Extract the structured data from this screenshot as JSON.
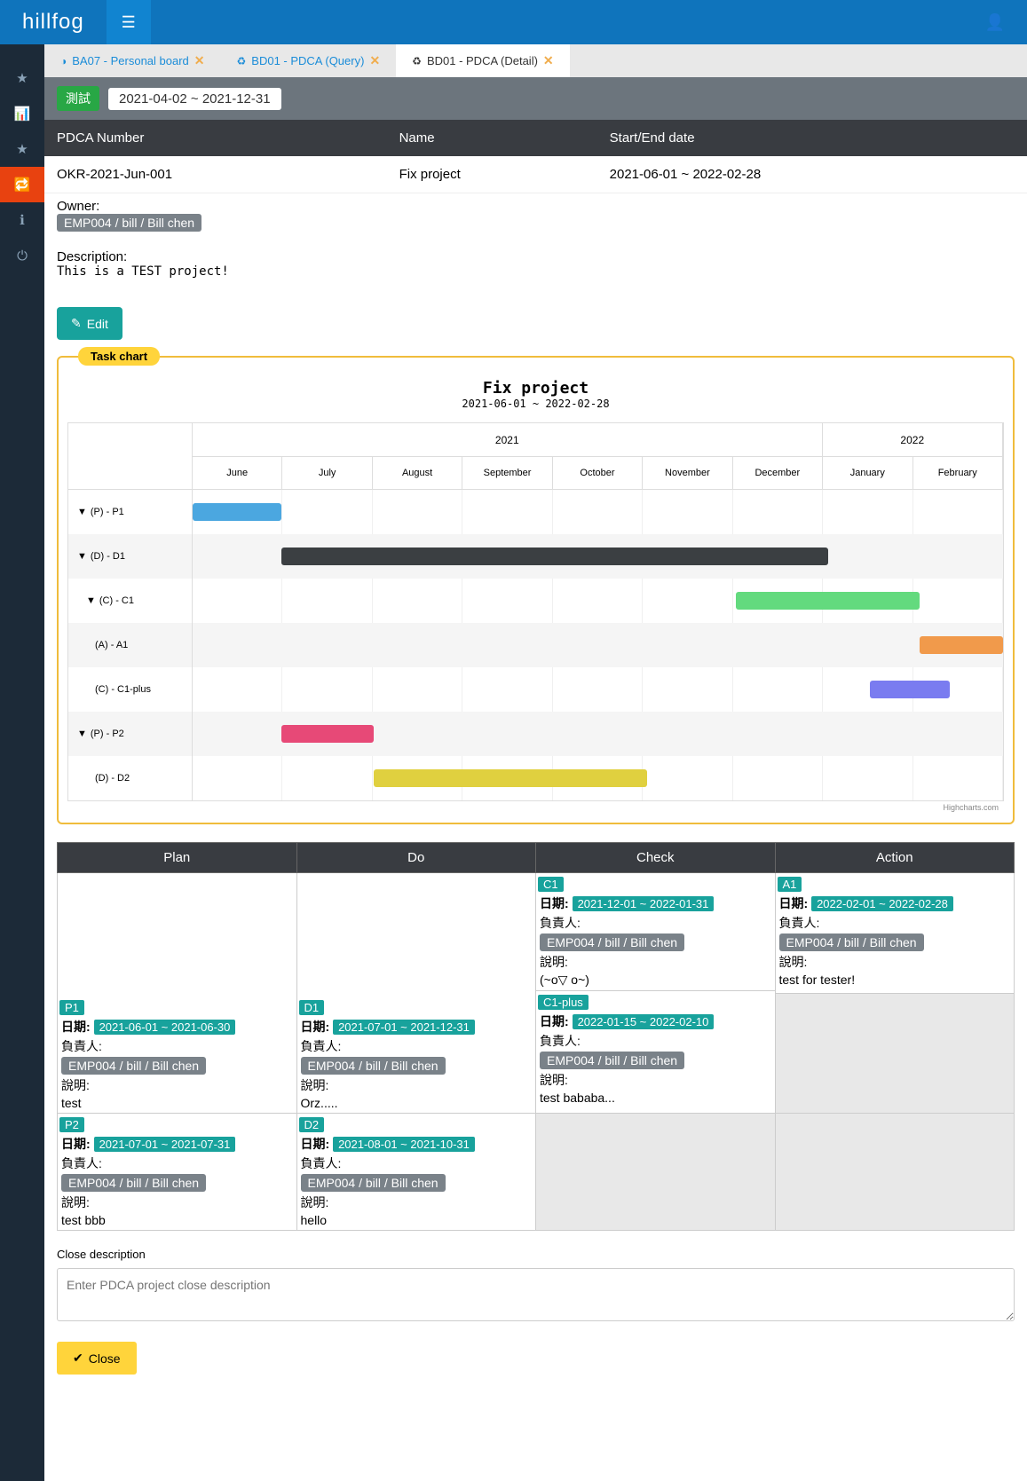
{
  "brand": "hillfog",
  "tabs": [
    {
      "label": "BA07 - Personal board",
      "active": false
    },
    {
      "label": "BD01 - PDCA (Query)",
      "active": false
    },
    {
      "label": "BD01 - PDCA (Detail)",
      "active": true
    }
  ],
  "test_badge": "測試",
  "date_range": "2021-04-02 ~ 2021-12-31",
  "headers": {
    "num": "PDCA Number",
    "name": "Name",
    "dates": "Start/End date"
  },
  "row": {
    "num": "OKR-2021-Jun-001",
    "name": "Fix project",
    "dates": "2021-06-01 ~ 2022-02-28"
  },
  "owner": {
    "label": "Owner:",
    "chip": "EMP004 / bill / Bill chen"
  },
  "desc": {
    "label": "Description:",
    "text": "This is a TEST project!"
  },
  "edit_btn": "Edit",
  "task_chart_badge": "Task chart",
  "chart_title": "Fix project",
  "chart_sub": "2021-06-01 ~ 2022-02-28",
  "y2021": "2021",
  "y2022": "2022",
  "months": [
    "June",
    "July",
    "August",
    "September",
    "October",
    "November",
    "December",
    "January",
    "February"
  ],
  "rows_labels": [
    "(P) - P1",
    "(D) - D1",
    "(C) - C1",
    "(A) - A1",
    "(C) - C1-plus",
    "(P) - P2",
    "(D) - D2"
  ],
  "rows_toggle": [
    true,
    true,
    true,
    false,
    false,
    true,
    false
  ],
  "credit": "Highcharts.com",
  "grid_headers": [
    "Plan",
    "Do",
    "Check",
    "Action"
  ],
  "cards": {
    "P1": {
      "tag": "P1",
      "date": "2021-06-01 ~ 2021-06-30",
      "desc": "test"
    },
    "D1": {
      "tag": "D1",
      "date": "2021-07-01 ~ 2021-12-31",
      "desc": "Orz....."
    },
    "C1": {
      "tag": "C1",
      "date": "2021-12-01 ~ 2022-01-31",
      "desc": "(~o▽ o~)"
    },
    "C1p": {
      "tag": "C1-plus",
      "date": "2022-01-15 ~ 2022-02-10",
      "desc": "test bababa..."
    },
    "A1": {
      "tag": "A1",
      "date": "2022-02-01 ~ 2022-02-28",
      "desc": "test for tester!"
    },
    "P2": {
      "tag": "P2",
      "date": "2021-07-01 ~ 2021-07-31",
      "desc": "test bbb"
    },
    "D2": {
      "tag": "D2",
      "date": "2021-08-01 ~ 2021-10-31",
      "desc": "hello"
    }
  },
  "labels": {
    "date": "日期:",
    "owner": "負責人:",
    "emp": "EMP004 / bill / Bill chen",
    "desc": "說明:"
  },
  "close": {
    "label": "Close description",
    "placeholder": "Enter PDCA project close description",
    "btn": "Close"
  },
  "chart_data": {
    "type": "gantt",
    "title": "Fix project",
    "subtitle": "2021-06-01 ~ 2022-02-28",
    "x_categories": [
      "June",
      "July",
      "August",
      "September",
      "October",
      "November",
      "December",
      "January",
      "February"
    ],
    "year_groups": [
      {
        "label": "2021",
        "span": 7
      },
      {
        "label": "2022",
        "span": 2
      }
    ],
    "tasks": [
      {
        "name": "(P) - P1",
        "start": "2021-06-01",
        "end": "2021-06-30",
        "color": "#4ba7e0",
        "deps": []
      },
      {
        "name": "(D) - D1",
        "start": "2021-07-01",
        "end": "2021-12-31",
        "color": "#3b3f42",
        "deps": [
          "(P) - P1"
        ]
      },
      {
        "name": "(C) - C1",
        "start": "2021-12-01",
        "end": "2022-01-31",
        "color": "#63da7e",
        "deps": [
          "(D) - D1"
        ]
      },
      {
        "name": "(A) - A1",
        "start": "2022-02-01",
        "end": "2022-02-28",
        "color": "#f19a4b",
        "deps": [
          "(C) - C1"
        ]
      },
      {
        "name": "(C) - C1-plus",
        "start": "2022-01-15",
        "end": "2022-02-10",
        "color": "#7a7cf0",
        "deps": [
          "(D) - D1"
        ]
      },
      {
        "name": "(P) - P2",
        "start": "2021-07-01",
        "end": "2021-07-31",
        "color": "#e74977",
        "deps": []
      },
      {
        "name": "(D) - D2",
        "start": "2021-08-01",
        "end": "2021-10-31",
        "color": "#e0d03f",
        "deps": [
          "(P) - P2"
        ]
      }
    ]
  }
}
